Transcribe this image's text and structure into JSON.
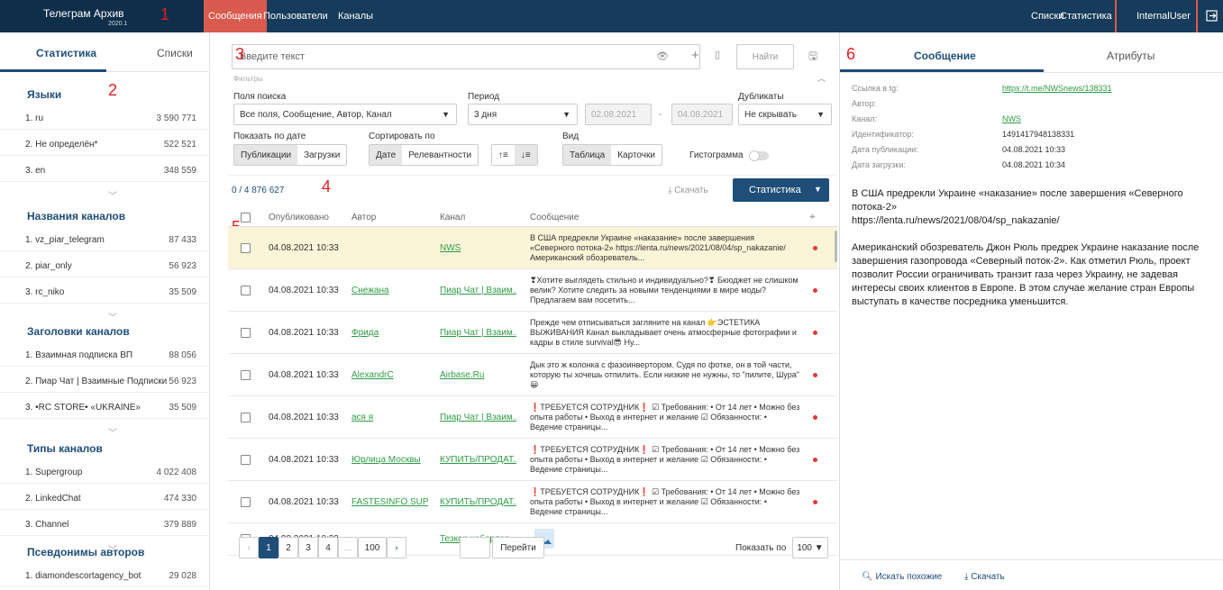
{
  "app": {
    "title": "Телеграм Архив",
    "version": "2020.1"
  },
  "nav": {
    "items": [
      "Сообщения",
      "Пользователи",
      "Каналы"
    ],
    "active": 0,
    "right": [
      "Списки",
      "Статистика"
    ],
    "user": "InternalUser"
  },
  "labels": [
    "1",
    "2",
    "3",
    "4",
    "5",
    "6"
  ],
  "left": {
    "tabs": [
      "Статистика",
      "Списки"
    ],
    "sections": [
      {
        "title": "Языки",
        "rows": [
          [
            "1.  ru",
            "3 590 771"
          ],
          [
            "2.  Не определён*",
            "522 521"
          ],
          [
            "3.  en",
            "348 559"
          ]
        ]
      },
      {
        "title": "Названия каналов",
        "rows": [
          [
            "1.  vz_piar_telegram",
            "87 433"
          ],
          [
            "2.  piar_only",
            "56 923"
          ],
          [
            "3.  rc_niko",
            "35 509"
          ]
        ]
      },
      {
        "title": "Заголовки каналов",
        "rows": [
          [
            "1.  Взаимная подписка ВП",
            "88 056"
          ],
          [
            "2.  Пиар Чат | Взаимные Подписки",
            "56 923"
          ],
          [
            "3.  •RC STORE• «UKRAINE»",
            "35 509"
          ]
        ]
      },
      {
        "title": "Типы каналов",
        "rows": [
          [
            "1.  Supergroup",
            "4 022 408"
          ],
          [
            "2.  LinkedChat",
            "474 330"
          ],
          [
            "3.  Channel",
            "379 889"
          ]
        ]
      },
      {
        "title": "Псевдонимы авторов",
        "rows": [
          [
            "1.  diamondescortagency_bot",
            "29 028"
          ]
        ]
      }
    ]
  },
  "search": {
    "placeholder": "Введите текст",
    "find": "Найти"
  },
  "filters": {
    "title": "Фильтры",
    "fields_label": "Поля поиска",
    "fields_value": "Все поля, Сообщение, Автор, Канал",
    "period_label": "Период",
    "period_value": "3 дня",
    "date_from": "02.08.2021",
    "date_to": "04.08.2021",
    "dup_label": "Дубликаты",
    "dup_value": "Не скрывать",
    "show_label": "Показать по дате",
    "show_opts": [
      "Публикации",
      "Загрузки"
    ],
    "sort_label": "Сортировать по",
    "sort_opts": [
      "Дате",
      "Релевантности"
    ],
    "view_label": "Вид",
    "view_opts": [
      "Таблица",
      "Карточки"
    ],
    "histogram": "Гистограмма"
  },
  "results": {
    "count": "0 / 4 876 627",
    "download": "Скачать",
    "stats": "Статистика"
  },
  "table": {
    "headers": [
      "Опубликовано",
      "Автор",
      "Канал",
      "Сообщение"
    ],
    "rows": [
      {
        "date": "04.08.2021 10:33",
        "author": "",
        "channel": "NWS",
        "msg": "В США предрекли Украине «наказание» после завершения «Северного потока-2» https://lenta.ru/news/2021/08/04/sp_nakazanie/ Американский обозреватель...",
        "selected": true
      },
      {
        "date": "04.08.2021 10:33",
        "author": "Снежана",
        "channel": "Пиар Чат | Взаим...",
        "msg": "❣Хотите выглядеть стильно и индивидуально?❣ Бюоджет не слишком велик? Хотите следить за новыми тенденциями в мире моды? Предлагаем вам посетить..."
      },
      {
        "date": "04.08.2021 10:33",
        "author": "Фрида",
        "channel": "Пиар Чат | Взаим...",
        "msg": "Прежде чем отписываться загляните на канал 👉ЭСТЕТИКА ВЫЖИВАНИЯ Канал выкладывает очень атмосферные фотографии и кадры в стиле survival😎 Ну..."
      },
      {
        "date": "04.08.2021 10:33",
        "author": "AlexandrC",
        "channel": "Airbase.Ru",
        "msg": "Дык это ж колонка с фазоинвертором. Судя по фотке, он в той части, которую ты хочешь отпилить. Если низкие не нужны, то \"пилите, Шура\" 😀"
      },
      {
        "date": "04.08.2021 10:33",
        "author": "ася я",
        "channel": "Пиар Чат | Взаим...",
        "msg": "❗ТРЕБУЕТСЯ СОТРУДНИК❗ ☑ Требования: • От 14 лет • Можно без опыта работы • Выход в интернет и желание ☑ Обязанности: • Ведение страницы..."
      },
      {
        "date": "04.08.2021 10:33",
        "author": "Юрлица Москвы",
        "channel": "КУПИТЬ/ПРОДАТ...",
        "msg": "❗ТРЕБУЕТСЯ СОТРУДНИК❗ ☑ Требования: • От 14 лет • Можно без опыта работы • Выход в интернет и желание ☑ Обязанности: • Ведение страницы..."
      },
      {
        "date": "04.08.2021 10:33",
        "author": "FASTESINFO SUPP...",
        "channel": "КУПИТЬ/ПРОДАТ...",
        "msg": "❗ТРЕБУЕТСЯ СОТРУДНИК❗ ☑ Требования: • От 14 лет • Можно без опыта работы • Выход в интернет и желание ☑ Обязанности: • Ведение страницы..."
      },
      {
        "date": "04.08.2021 10:33",
        "author": "",
        "channel": "Тезкор хабарлар ...",
        "msg": ""
      }
    ]
  },
  "pager": {
    "pages": [
      "1",
      "2",
      "3",
      "4",
      "...",
      "100"
    ],
    "goto": "Перейти",
    "per_page_label": "Показать по",
    "per_page": "100"
  },
  "right": {
    "tabs": [
      "Сообщение",
      "Атрибуты"
    ],
    "attrs": [
      [
        "Ссылка в tg:",
        "https://t.me/NWSnews/138331"
      ],
      [
        "Автор:",
        ""
      ],
      [
        "Канал:",
        "NWS"
      ],
      [
        "Идентификатор:",
        "1491417948138331"
      ],
      [
        "Дата публикации:",
        "04.08.2021 10:33"
      ],
      [
        "Дата загрузки:",
        "04.08.2021 10:34"
      ]
    ],
    "message_p1": "В США предрекли Украине «наказание» после завершения «Северного потока-2»",
    "message_p2": "https://lenta.ru/news/2021/08/04/sp_nakazanie/",
    "message_p3": "Американский обозреватель Джон Рюль предрек Украине наказание после завершения газопровода «Северный поток-2». Как отметил Рюль, проект позволит России ограничивать транзит газа через Украину, не задевая интересы своих клиентов в Европе. В этом случае желание стран Европы выступать в качестве посредника уменьшится.",
    "find_similar": "Искать похожие",
    "download": "Скачать"
  }
}
